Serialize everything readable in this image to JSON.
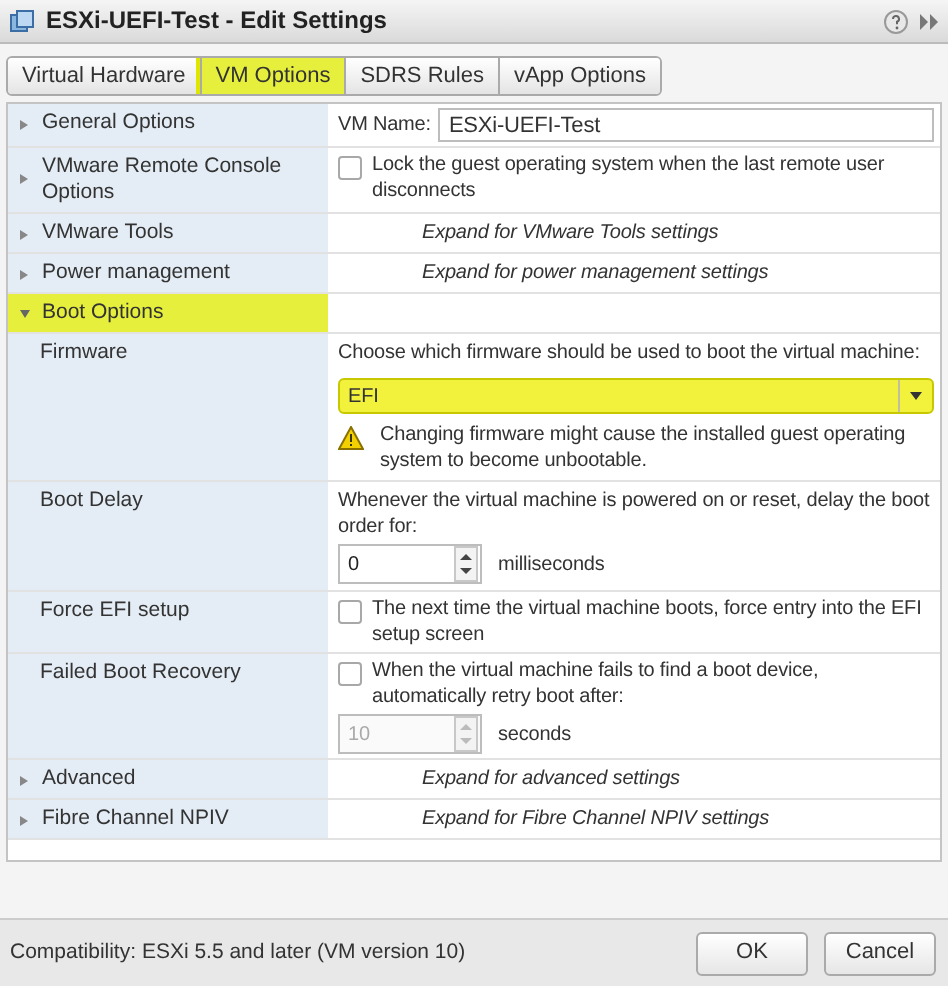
{
  "window": {
    "title": "ESXi-UEFI-Test - Edit Settings"
  },
  "tabs": [
    {
      "label": "Virtual Hardware",
      "selected": false
    },
    {
      "label": "VM Options",
      "selected": true
    },
    {
      "label": "SDRS Rules",
      "selected": false
    },
    {
      "label": "vApp Options",
      "selected": false
    }
  ],
  "rows": [
    {
      "label": "General Options",
      "section": true,
      "expanded": false,
      "highlighted": false,
      "kind": "text_field",
      "field_label": "VM Name:",
      "value": "ESXi-UEFI-Test"
    },
    {
      "label": "VMware Remote Console Options",
      "section": true,
      "expanded": false,
      "highlighted": false,
      "kind": "checkbox",
      "checked": false,
      "text": "Lock the guest operating system when the last remote user disconnects"
    },
    {
      "label": "VMware Tools",
      "section": true,
      "expanded": false,
      "highlighted": false,
      "kind": "hint",
      "text": "Expand for VMware Tools settings"
    },
    {
      "label": "Power management",
      "section": true,
      "expanded": false,
      "highlighted": false,
      "kind": "hint",
      "text": "Expand for power management settings"
    },
    {
      "label": "Boot Options",
      "section": true,
      "expanded": true,
      "highlighted": true,
      "kind": "empty"
    },
    {
      "label": "Firmware",
      "section": false,
      "highlighted": false,
      "kind": "select",
      "text": "Choose which firmware should be used to boot the virtual machine:",
      "value": "EFI",
      "select_highlighted": true,
      "warning": "Changing firmware might cause the installed guest operating system to become unbootable."
    },
    {
      "label": "Boot Delay",
      "section": false,
      "highlighted": false,
      "kind": "spinner",
      "text": "Whenever the virtual machine is powered on or reset, delay the boot order for:",
      "value": "0",
      "unit": "milliseconds",
      "disabled": false
    },
    {
      "label": "Force EFI setup",
      "section": false,
      "highlighted": false,
      "kind": "checkbox",
      "checked": false,
      "text": "The next time the virtual machine boots, force entry into the EFI setup screen"
    },
    {
      "label": "Failed Boot Recovery",
      "section": false,
      "highlighted": false,
      "kind": "checkbox_spinner",
      "checked": false,
      "text": "When the virtual machine fails to find a boot device, automatically retry boot after:",
      "value": "10",
      "unit": "seconds",
      "disabled": true
    },
    {
      "label": "Advanced",
      "section": true,
      "expanded": false,
      "highlighted": false,
      "kind": "hint",
      "text": "Expand for advanced settings"
    },
    {
      "label": "Fibre Channel NPIV",
      "section": true,
      "expanded": false,
      "highlighted": false,
      "kind": "hint",
      "text": "Expand for Fibre Channel NPIV settings"
    }
  ],
  "footer": {
    "compatibility": "Compatibility: ESXi 5.5 and later (VM version 10)",
    "buttons": [
      "OK",
      "Cancel"
    ]
  }
}
